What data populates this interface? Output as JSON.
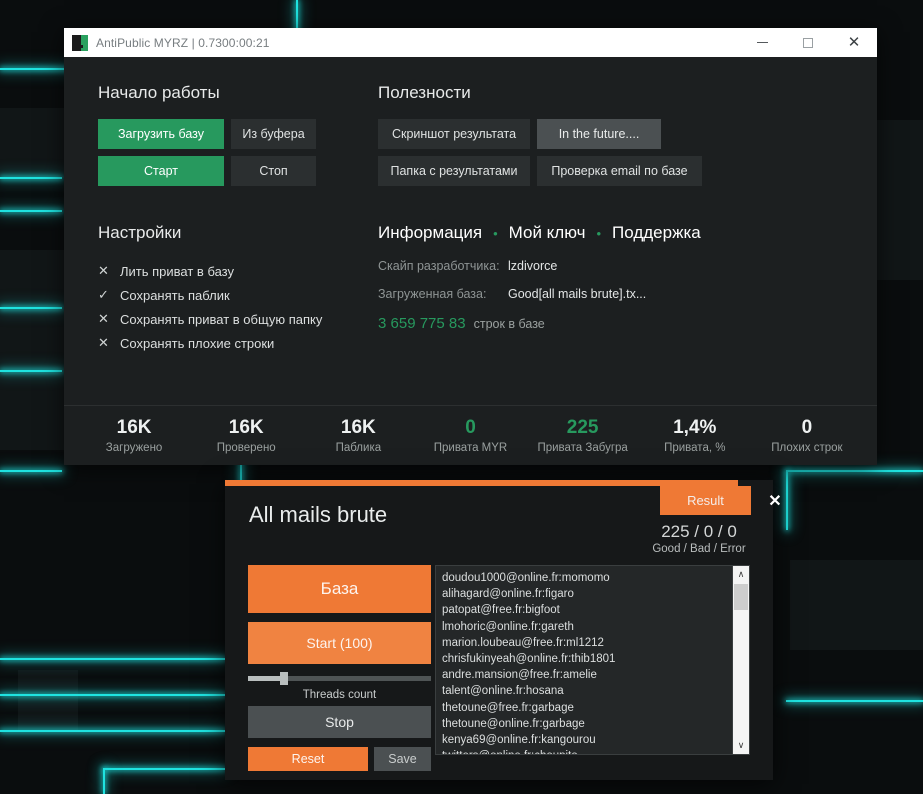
{
  "desktop": {
    "accent_cyan": "#1fe3e0",
    "bg": "#0a0d0e"
  },
  "main_window": {
    "titlebar": {
      "title": "AntiPublic MYRZ  | 0.7300:00:21",
      "minimize_label": "–",
      "maximize_label": "",
      "close_label": "✕"
    },
    "getting_started": {
      "heading": "Начало работы",
      "buttons": [
        {
          "label": "Загрузить базу",
          "style": "green"
        },
        {
          "label": "Из буфера",
          "style": "dark"
        },
        {
          "label": "Старт",
          "style": "green"
        },
        {
          "label": "Стоп",
          "style": "dark"
        }
      ]
    },
    "utilities": {
      "heading": "Полезности",
      "buttons": [
        {
          "label": "Скриншот результата",
          "style": "dark"
        },
        {
          "label": "In the future....",
          "style": "grey"
        },
        {
          "label": "Папка с результатами",
          "style": "dark"
        },
        {
          "label": "Проверка email по базе",
          "style": "dark"
        }
      ]
    },
    "settings": {
      "heading": "Настройки",
      "options": [
        {
          "label": "Лить приват в базу",
          "mark": "✕",
          "checked": false
        },
        {
          "label": "Сохранять паблик",
          "mark": "✓",
          "checked": true
        },
        {
          "label": "Сохранять приват в общую папку",
          "mark": "✕",
          "checked": false
        },
        {
          "label": "Сохранять плохие строки",
          "mark": "✕",
          "checked": false
        }
      ]
    },
    "information": {
      "nav": [
        {
          "label": "Информация"
        },
        {
          "label": "Мой ключ"
        },
        {
          "label": "Поддержка"
        }
      ],
      "separator": "•",
      "skype_label": "Скайп разработчика:",
      "skype_value": "lzdivorce",
      "database_label": "Загруженная база:",
      "database_value": "Good[all mails brute].tx...",
      "lines_count": "3 659 775 83",
      "lines_label": "строк в базе"
    },
    "stats": [
      {
        "value": "16K",
        "label": "Загружено",
        "green": false
      },
      {
        "value": "16K",
        "label": "Проверено",
        "green": false
      },
      {
        "value": "16K",
        "label": "Паблика",
        "green": false
      },
      {
        "value": "0",
        "label": "Привата MYR",
        "green": true
      },
      {
        "value": "225",
        "label": "Привата Забугра",
        "green": true
      },
      {
        "value": "1,4%",
        "label": "Привата, %",
        "green": false
      },
      {
        "value": "0",
        "label": "Плохих строк",
        "green": false
      }
    ]
  },
  "brute_window": {
    "title": "All mails brute",
    "result_tab_label": "Result",
    "close_label": "✕",
    "counts": "225 / 0 / 0",
    "counts_legend": "Good / Bad / Error",
    "accent_orange": "#ef7935",
    "buttons": {
      "baza": "База",
      "start": "Start (100)",
      "stop": "Stop",
      "reset": "Reset",
      "save": "Save"
    },
    "threads_label": "Threads count",
    "threads_value": 100,
    "scrollbar": {
      "up": "∧",
      "down": "∨"
    },
    "results": [
      "doudou1000@online.fr:momomo",
      "alihagard@online.fr:figaro",
      "patopat@free.fr:bigfoot",
      "lmohoric@online.fr:gareth",
      "marion.loubeau@free.fr:ml1212",
      "chrisfukinyeah@online.fr:thib1801",
      "andre.mansion@free.fr:amelie",
      "talent@online.fr:hosana",
      "thetoune@free.fr:garbage",
      "thetoune@online.fr:garbage",
      "kenya69@online.fr:kangourou",
      "twitters@online.fr:choupito"
    ]
  }
}
